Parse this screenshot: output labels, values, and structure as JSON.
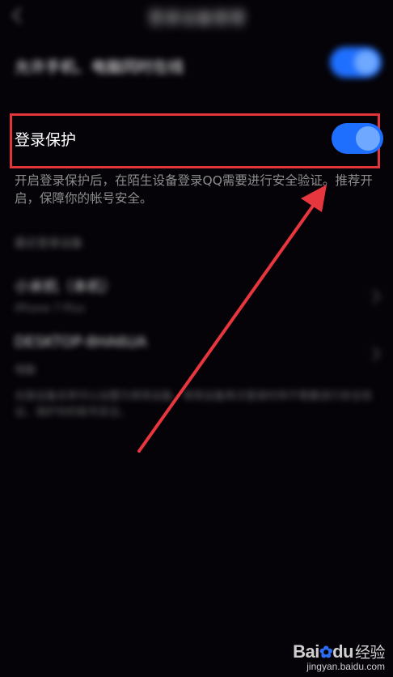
{
  "header": {
    "title": "登录设备管理"
  },
  "rows": {
    "online_label": "允许手机、电脑同时在线",
    "protect_label": "登录保护",
    "protect_description": "开启登录保护后，在陌生设备登录QQ需要进行安全验证。推荐开启，保障你的帐号安全。"
  },
  "devices": {
    "section_header": "最近登录设备",
    "items": [
      {
        "name": "小米机（本机）",
        "sub": "iPhone 7 Plus"
      },
      {
        "name": "DESKTOP-8HA6UA",
        "sub": "电脑"
      }
    ]
  },
  "footer": {
    "note": "长按设备名称可以设置为常用设备，常用设备再次登录时将不需要进行安全验证，保护你的账号安全。"
  },
  "watermark": {
    "logo_a": "Bai",
    "logo_b": "du",
    "logo_cn": "经验",
    "url": "jingyan.baidu.com"
  },
  "colors": {
    "toggle_on": "#1f6fff",
    "highlight": "#e1353c",
    "arrow": "#e7363d"
  }
}
